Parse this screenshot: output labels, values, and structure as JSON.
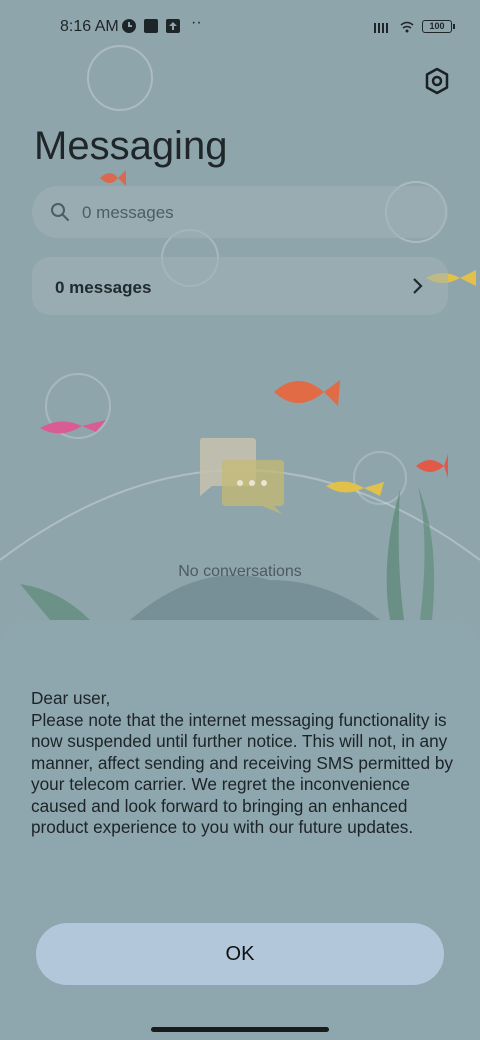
{
  "status_bar": {
    "time": "8:16 AM",
    "battery": "100"
  },
  "header": {
    "title": "Messaging",
    "settings_icon": "hexagon-settings-icon"
  },
  "search": {
    "placeholder": "0 messages"
  },
  "message_row": {
    "label": "0 messages"
  },
  "empty_state": {
    "text": "No conversations"
  },
  "notice_sheet": {
    "greeting": "Dear user,",
    "body": "Please note that the internet messaging functionality is now suspended until further notice. This will not, in any manner, affect sending and receiving SMS permitted by your telecom carrier. We regret the inconvenience caused and look forward to bringing an enhanced product experience to you with our future updates.",
    "ok_label": "OK"
  },
  "colors": {
    "background": "#8fa5ac",
    "sheet": "#8ea6ad",
    "ok_button": "#b2c7d9"
  }
}
